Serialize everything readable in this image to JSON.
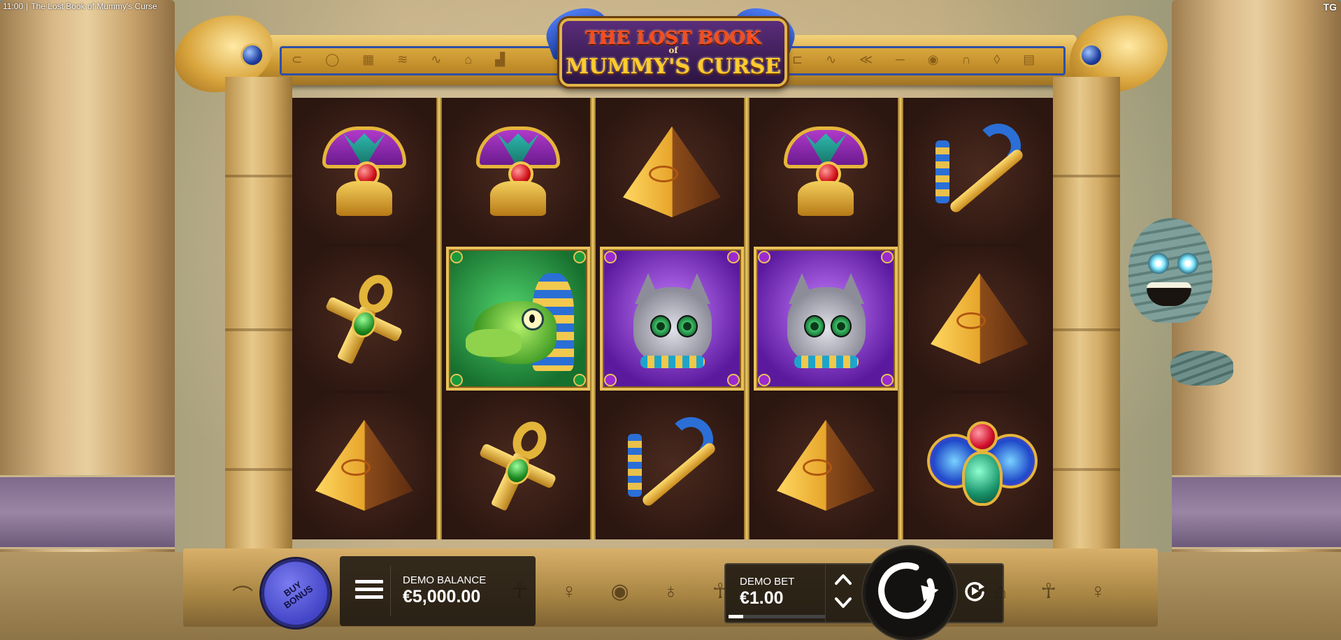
{
  "window": {
    "time": "11:00",
    "separator": "|",
    "title": "The Lost Book of Mummy's Curse",
    "corner_tag": "TG"
  },
  "logo": {
    "line1": "THE LOST BOOK",
    "line_of": "of",
    "line2": "MUMMY'S CURSE"
  },
  "reels": {
    "columns": 5,
    "rows": 3,
    "grid": [
      [
        "lotus",
        "lotus",
        "pyramid",
        "lotus",
        "crook-flail"
      ],
      [
        "ankh",
        "crocodile-pharaoh",
        "cat-goddess",
        "cat-goddess",
        "pyramid"
      ],
      [
        "pyramid",
        "ankh",
        "crook-flail",
        "pyramid",
        "scarab"
      ]
    ]
  },
  "controls": {
    "buy_bonus_label": "BUY BONUS",
    "balance_label": "DEMO BALANCE",
    "balance_value": "€5,000.00",
    "bet_label": "DEMO BET",
    "bet_value": "€1.00",
    "bet_level_fraction": 0.15
  },
  "colors": {
    "buy_bonus": "#5557d6",
    "frame_gold": "#e2b449",
    "reel_bg": "#2c1610"
  }
}
